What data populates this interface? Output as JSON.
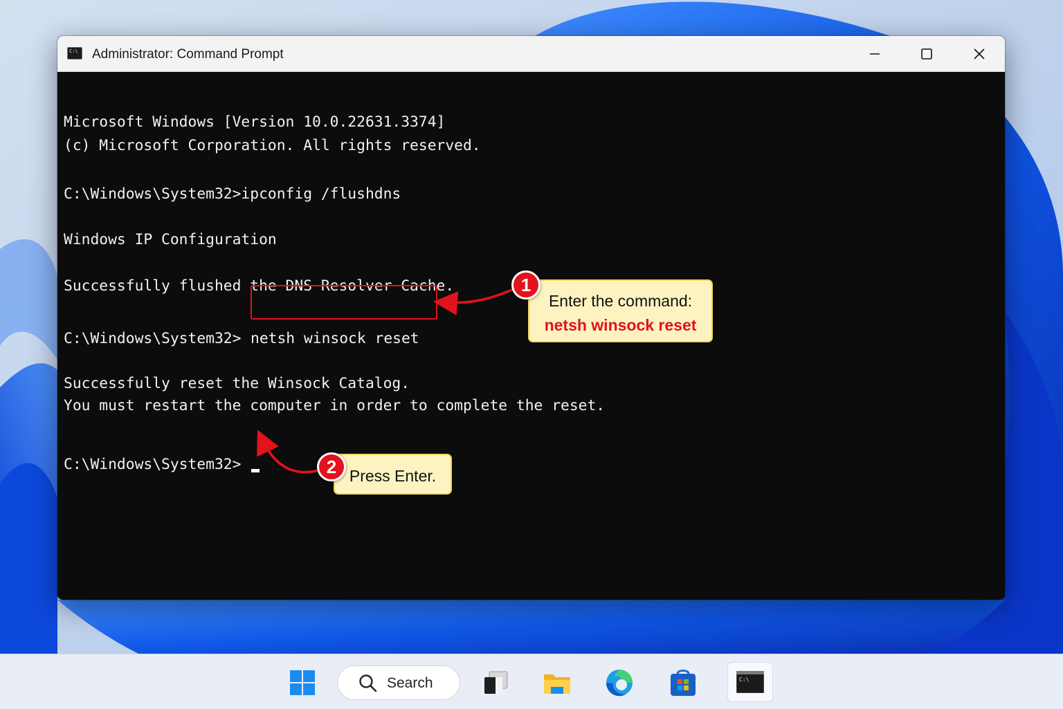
{
  "window": {
    "title": "Administrator: Command Prompt"
  },
  "terminal": {
    "lines": [
      "Microsoft Windows [Version 10.0.22631.3374]",
      "(c) Microsoft Corporation. All rights reserved.",
      "C:\\Windows\\System32>ipconfig /flushdns",
      "Windows IP Configuration",
      "Successfully flushed the DNS Resolver Cache.",
      "C:\\Windows\\System32>",
      "Successfully reset the Winsock Catalog.",
      "You must restart the computer in order to complete the reset.",
      "C:\\Windows\\System32>"
    ],
    "highlighted_command": "netsh winsock reset"
  },
  "annotations": {
    "step1": {
      "number": "1",
      "line1": "Enter the command:",
      "line2": "netsh winsock reset"
    },
    "step2": {
      "number": "2",
      "text": "Press Enter."
    },
    "accent_color": "#e3121c",
    "callout_color": "#fdf3c0"
  },
  "taskbar": {
    "search_label": "Search",
    "apps": [
      "start-icon",
      "task-view-icon",
      "file-explorer-icon",
      "edge-icon",
      "microsoft-store-icon",
      "command-prompt-icon"
    ]
  }
}
